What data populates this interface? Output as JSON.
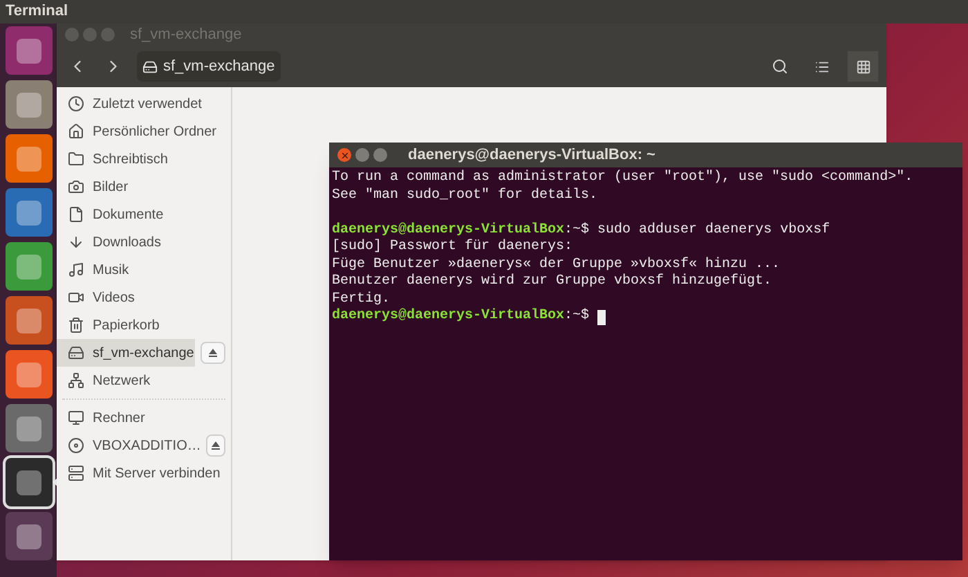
{
  "top_bar": {
    "title": "Terminal"
  },
  "launcher": [
    {
      "selected": false
    },
    {
      "selected": false
    },
    {
      "selected": false
    },
    {
      "selected": false
    },
    {
      "selected": false
    },
    {
      "selected": false
    },
    {
      "selected": false
    },
    {
      "selected": false
    },
    {
      "selected": true
    },
    {
      "selected": false
    }
  ],
  "files_window": {
    "title": "sf_vm-exchange",
    "path_button": "sf_vm-exchange",
    "view_grid_selected": true,
    "places": [
      {
        "label": "Zuletzt verwendet",
        "selected": false
      },
      {
        "label": "Persönlicher Ordner",
        "selected": false
      },
      {
        "label": "Schreibtisch",
        "selected": false
      },
      {
        "label": "Bilder",
        "selected": false
      },
      {
        "label": "Dokumente",
        "selected": false
      },
      {
        "label": "Downloads",
        "selected": false
      },
      {
        "label": "Musik",
        "selected": false
      },
      {
        "label": "Videos",
        "selected": false
      },
      {
        "label": "Papierkorb",
        "selected": false
      },
      {
        "label": "sf_vm-exchange",
        "selected": true,
        "eject": true
      },
      {
        "label": "Netzwerk",
        "selected": false
      }
    ],
    "devices": [
      {
        "label": "Rechner",
        "selected": false
      },
      {
        "label": "VBOXADDITIO…",
        "selected": false,
        "eject": true
      },
      {
        "label": "Mit Server verbinden",
        "selected": false
      }
    ]
  },
  "terminal": {
    "title": "daenerys@daenerys-VirtualBox: ~",
    "lines": [
      {
        "kind": "output",
        "text": "To run a command as administrator (user \"root\"), use \"sudo <command>\"."
      },
      {
        "kind": "output",
        "text": "See \"man sudo_root\" for details."
      },
      {
        "kind": "blank"
      },
      {
        "kind": "prompt",
        "user": "daenerys@daenerys-VirtualBox",
        "path": ":~$",
        "command": "sudo adduser daenerys vboxsf"
      },
      {
        "kind": "output",
        "text": "[sudo] Passwort für daenerys:"
      },
      {
        "kind": "output",
        "text": "Füge Benutzer »daenerys« der Gruppe »vboxsf« hinzu ..."
      },
      {
        "kind": "output",
        "text": "Benutzer daenerys wird zur Gruppe vboxsf hinzugefügt."
      },
      {
        "kind": "output",
        "text": "Fertig."
      },
      {
        "kind": "prompt",
        "user": "daenerys@daenerys-VirtualBox",
        "path": ":~$",
        "cursor": true
      }
    ]
  }
}
